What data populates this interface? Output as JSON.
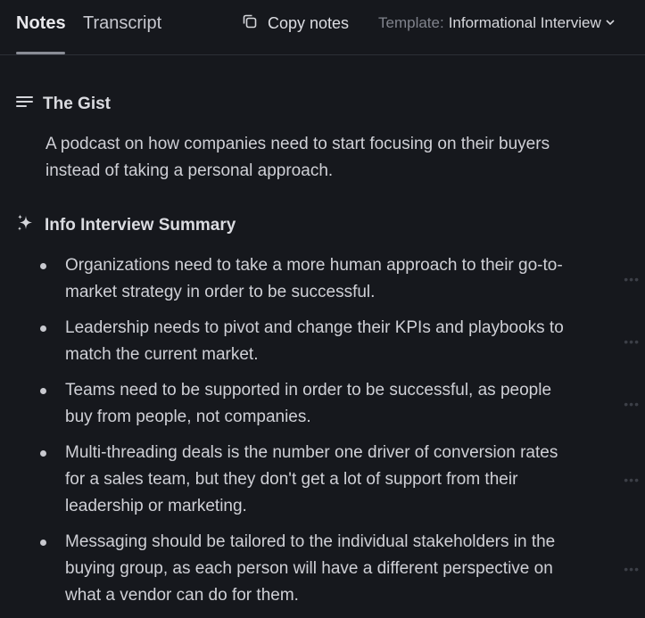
{
  "tabs": {
    "notes_label": "Notes",
    "transcript_label": "Transcript"
  },
  "toolbar": {
    "copy_label": "Copy notes",
    "template_prefix": "Template:",
    "template_value": "Informational Interview"
  },
  "gist": {
    "heading": "The Gist",
    "text": "A podcast on how companies need to start focusing on their buyers instead of taking a personal approach."
  },
  "summary": {
    "heading": "Info Interview Summary",
    "items": [
      {
        "text": "Organizations need to take a more human approach to their go-to-market strategy in order to be successful."
      },
      {
        "text": "Leadership needs to pivot and change their KPIs and playbooks to match the current market."
      },
      {
        "text": "Teams need to be supported in order to be successful, as people buy from people, not companies."
      },
      {
        "text": "Multi-threading deals is the number one driver of conversion rates for a sales team, but they don't get a lot of support from their leadership or marketing."
      },
      {
        "text": "Messaging should be tailored to the individual stakeholders in the buying group, as each person will have a different perspective on what a vendor can do for them."
      }
    ]
  },
  "icons": {
    "copy": "copy-icon",
    "chevron": "chevron-down-icon",
    "gist": "lines-icon",
    "summary": "sparkle-icon",
    "more": "more-options-icon"
  },
  "colors": {
    "background": "#16181d",
    "text": "#cfd0d6",
    "muted": "#80838c"
  }
}
